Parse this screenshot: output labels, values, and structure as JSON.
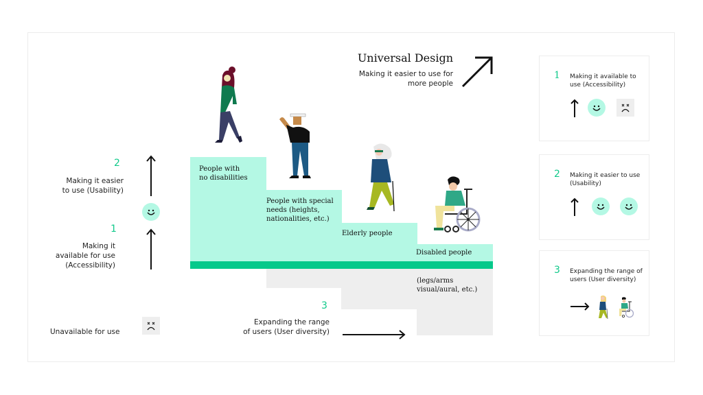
{
  "header": {
    "title": "Universal Design",
    "subtitle_line1": "Making it easier to use for",
    "subtitle_line2": "more people",
    "arrow_icon": "arrow-up-right-icon"
  },
  "left_axis": {
    "level2": {
      "number": "2",
      "line1": "Making it easier",
      "line2": "to use (Usability)"
    },
    "level1": {
      "number": "1",
      "line1": "Making it",
      "line2": "available for use",
      "line3": "(Accessibility)"
    },
    "unavailable": {
      "label": "Unavailable for use"
    }
  },
  "staircase": {
    "steps": [
      {
        "line1": "People with",
        "line2": "no disabilities",
        "figure": "walking-woman"
      },
      {
        "line1": "People with special",
        "line2": "needs (heights,",
        "line3": "nationalities, etc.)",
        "figure": "waving-man-with-hat"
      },
      {
        "line1": "Elderly people",
        "figure": "elderly-woman-with-cane"
      },
      {
        "line1": "Disabled people",
        "figure": "man-in-wheelchair"
      }
    ],
    "below_note_line1": "(legs/arms",
    "below_note_line2": "visual/aural, etc.)"
  },
  "bottom_axis": {
    "number": "3",
    "line1": "Expanding the range",
    "line2": "of users (User diversity)"
  },
  "colors": {
    "mint": "#b4f8e4",
    "green_bar": "#05c98b",
    "accent_number": "#10c98a",
    "grey": "#eeeeee"
  },
  "side_panels": [
    {
      "number": "1",
      "line1": "Making it available to",
      "line2": "use (Accessibility)",
      "icons": [
        "arrow-up-icon",
        "smiley-icon",
        "sad-face-icon"
      ]
    },
    {
      "number": "2",
      "line1": "Making it easier to use",
      "line2": "(Usability)",
      "icons": [
        "arrow-up-icon",
        "smiley-icon",
        "smiley-icon"
      ]
    },
    {
      "number": "3",
      "line1": "Expanding the range of",
      "line2": "users (User diversity)",
      "icons": [
        "arrow-right-icon",
        "elderly-woman-icon",
        "wheelchair-user-icon"
      ]
    }
  ]
}
